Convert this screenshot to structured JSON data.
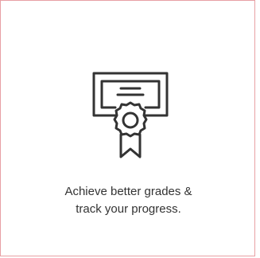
{
  "card": {
    "line1": "Achieve better grades &",
    "line2": "track your progress.",
    "border_color": "#e8a0a4",
    "text_color": "#333333"
  },
  "icon": {
    "name": "certificate-icon"
  }
}
